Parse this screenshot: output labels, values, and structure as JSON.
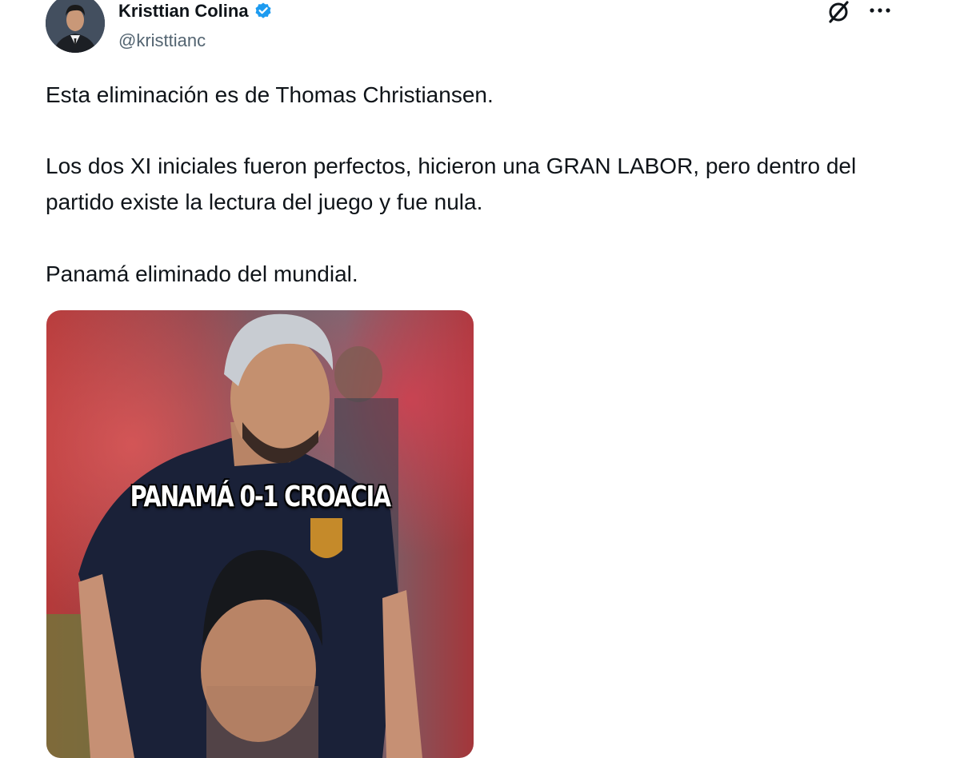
{
  "author": {
    "name": "Kristtian Colina",
    "handle": "@kristtianc",
    "verified": true
  },
  "actions": {
    "grok_icon": "grok-icon",
    "more_icon": "more-icon"
  },
  "tweet": {
    "paragraph_1": "Esta eliminación es de Thomas Christiansen.",
    "paragraph_2": "Los dos XI iniciales fueron perfectos, hicieron una GRAN LABOR, pero dentro del partido existe la lectura del juego y fue nula.",
    "paragraph_3": "Panamá eliminado del mundial."
  },
  "media": {
    "overlay_text": "PANAMÁ 0-1 CROACIA"
  },
  "colors": {
    "text": "#0f1419",
    "secondary": "#536471",
    "verified": "#1d9bf0"
  }
}
